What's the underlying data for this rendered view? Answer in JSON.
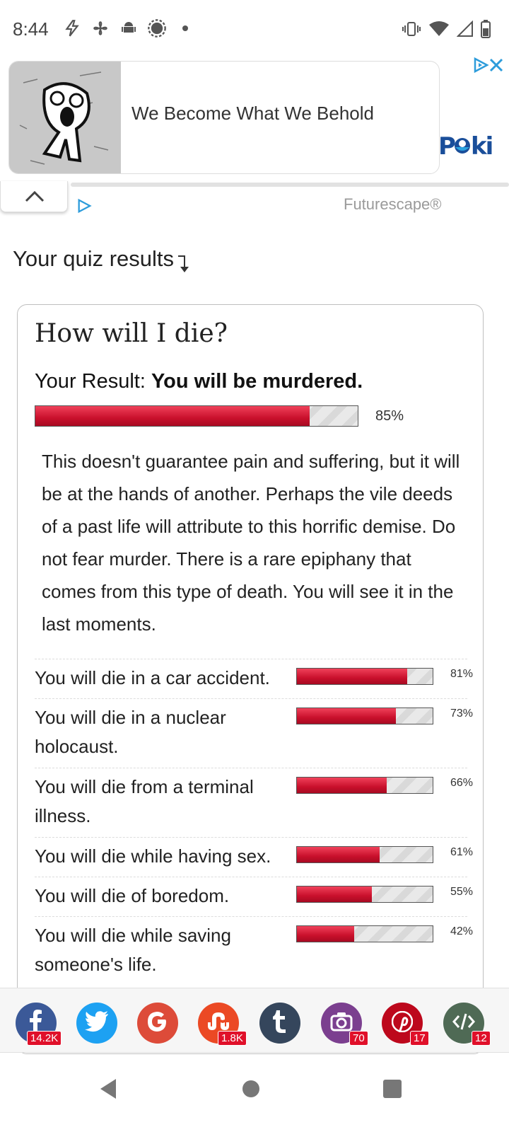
{
  "status_bar": {
    "time": "8:44",
    "left_icons": [
      "bolt-icon",
      "fan-icon",
      "android-icon",
      "brightness-icon",
      "dot-icon"
    ],
    "right_icons": [
      "vibrate-icon",
      "wifi-icon",
      "signal-icon",
      "battery-icon"
    ]
  },
  "ad": {
    "title": "We Become What We Behold",
    "brand": "POKI",
    "sub_label": "Futurescape®"
  },
  "quiz": {
    "heading": "Your quiz results",
    "title": "How will I die?",
    "result_prefix": "Your Result: ",
    "result_value": "You will be murdered.",
    "result_percent": 85,
    "result_percent_label": "85%",
    "description": "This doesn't guarantee pain and suffering, but it will be at the hands of another. Perhaps the vile deeds of a past life will attribute to this horrific demise. Do not fear murder. There is a rare epiphany that comes from this type of death. You will see it in the last moments.",
    "others": [
      {
        "label": "You will die in a car accident.",
        "percent": 81,
        "percent_label": "81%"
      },
      {
        "label": "You will die in a nuclear holocaust.",
        "percent": 73,
        "percent_label": "73%"
      },
      {
        "label": "You will die from a terminal illness.",
        "percent": 66,
        "percent_label": "66%"
      },
      {
        "label": "You will die while having sex.",
        "percent": 61,
        "percent_label": "61%"
      },
      {
        "label": "You will die of boredom.",
        "percent": 55,
        "percent_label": "55%"
      },
      {
        "label": "You will die while saving someone's life.",
        "percent": 42,
        "percent_label": "42%"
      }
    ]
  },
  "share": [
    {
      "name": "facebook",
      "icon": "facebook-icon",
      "color": "#3b5998",
      "count": "14.2K"
    },
    {
      "name": "twitter",
      "icon": "twitter-icon",
      "color": "#1da1f2",
      "count": ""
    },
    {
      "name": "google",
      "icon": "google-icon",
      "color": "#dd4b39",
      "count": ""
    },
    {
      "name": "stumbleupon",
      "icon": "stumbleupon-icon",
      "color": "#eb4924",
      "count": "1.8K"
    },
    {
      "name": "tumblr",
      "icon": "tumblr-icon",
      "color": "#35465c",
      "count": ""
    },
    {
      "name": "instagram",
      "icon": "camera-icon",
      "color": "#7b3f8f",
      "count": "70"
    },
    {
      "name": "pinterest",
      "icon": "pinterest-icon",
      "color": "#bd081c",
      "count": "17"
    },
    {
      "name": "embed",
      "icon": "code-icon",
      "color": "#4f6a55",
      "count": "12"
    }
  ],
  "colors": {
    "bar_red": "#c9102c",
    "badge_red": "#e0102a"
  }
}
